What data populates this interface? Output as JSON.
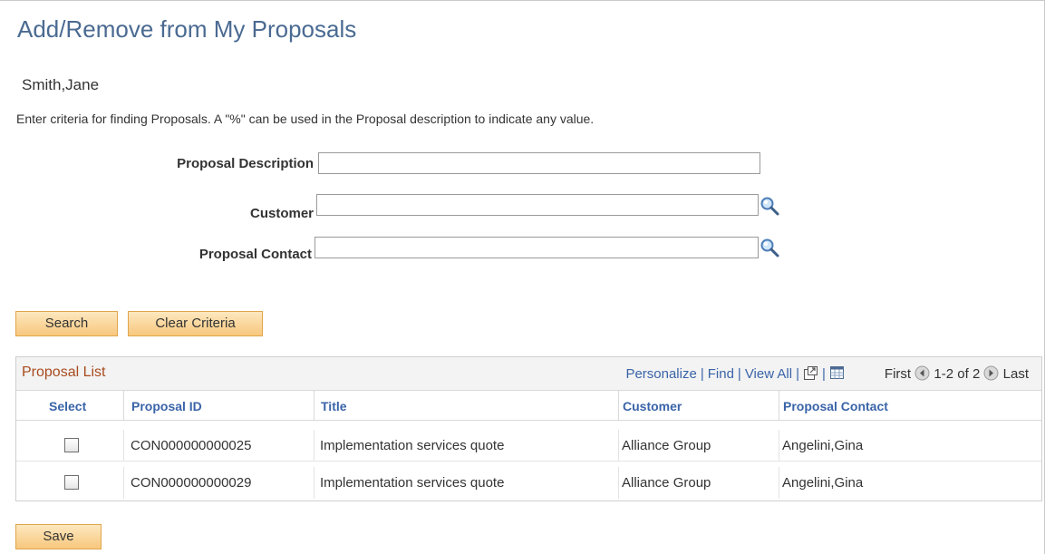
{
  "page": {
    "title": "Add/Remove from My Proposals",
    "person": "Smith,Jane",
    "instructions": "Enter criteria for finding Proposals. A \"%\" can be used in the Proposal description to indicate any value."
  },
  "criteria": {
    "proposal_description_label": "Proposal Description",
    "proposal_description_value": "",
    "customer_label": "Customer",
    "customer_value": "",
    "proposal_contact_label": "Proposal Contact",
    "proposal_contact_value": ""
  },
  "buttons": {
    "search": "Search",
    "clear_criteria": "Clear Criteria",
    "save": "Save"
  },
  "grid": {
    "title": "Proposal List",
    "nav": {
      "personalize": "Personalize",
      "find": "Find",
      "view_all": "View All",
      "first": "First",
      "range": "1-2 of 2",
      "last": "Last"
    },
    "columns": [
      "Select",
      "Proposal ID",
      "Title",
      "Customer",
      "Proposal Contact"
    ],
    "rows": [
      {
        "selected": false,
        "proposal_id": "CON000000000025",
        "title": "Implementation services quote",
        "customer": "Alliance Group",
        "contact": "Angelini,Gina"
      },
      {
        "selected": false,
        "proposal_id": "CON000000000029",
        "title": "Implementation services quote",
        "customer": "Alliance Group",
        "contact": "Angelini,Gina"
      }
    ]
  },
  "icons": {
    "lookup": "magnifier-lookup-icon",
    "zoom": "new-window-icon",
    "download": "grid-download-icon",
    "first": "first-arrow-icon",
    "last": "last-arrow-icon"
  },
  "colors": {
    "title": "#4a6a92",
    "link": "#3a64a8",
    "grid_title": "#a84b1d",
    "button_fill": "#f7c77d",
    "button_border": "#e0a54c"
  }
}
